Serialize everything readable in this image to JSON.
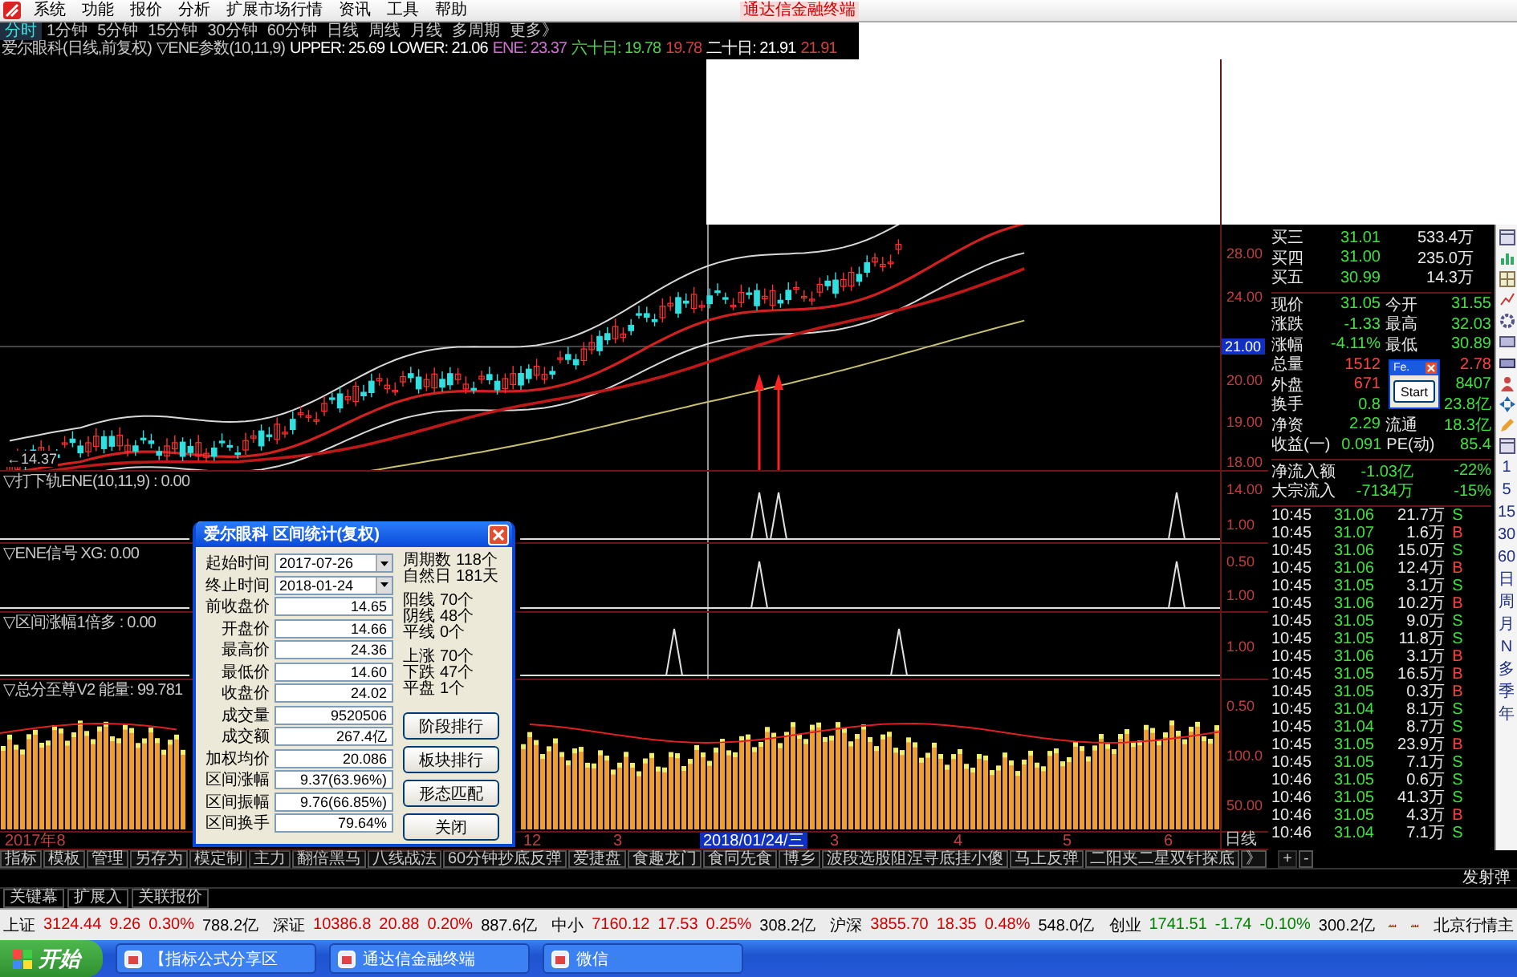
{
  "menu": {
    "items": [
      "系统",
      "功能",
      "报价",
      "分析",
      "扩展市场行情",
      "资讯",
      "工具",
      "帮助"
    ],
    "brand": "通达信金融终端"
  },
  "periods": [
    {
      "label": "分时",
      "selected": true
    },
    {
      "label": "1分钟",
      "selected": false
    },
    {
      "label": "5分钟",
      "selected": false
    },
    {
      "label": "15分钟",
      "selected": false
    },
    {
      "label": "30分钟",
      "selected": false
    },
    {
      "label": "60分钟",
      "selected": false
    },
    {
      "label": "日线",
      "selected": false
    },
    {
      "label": "周线",
      "selected": false
    },
    {
      "label": "月线",
      "selected": false
    },
    {
      "label": "多周期",
      "selected": false
    },
    {
      "label": "更多》",
      "selected": false
    }
  ],
  "indicator_line": [
    {
      "text": "爱尔眼科(日线,前复权)",
      "color": "#c8c8c8"
    },
    {
      "text": "▽ENE参数(10,11,9)",
      "color": "#c8c8c8"
    },
    {
      "text": "UPPER: 25.69",
      "color": "#ffffff"
    },
    {
      "text": "LOWER: 21.06",
      "color": "#ffffff"
    },
    {
      "text": "ENE: 23.37",
      "color": "#d070d0"
    },
    {
      "text": "六十日: 19.78",
      "color": "#50d050"
    },
    {
      "text": "19.78",
      "color": "#d04040"
    },
    {
      "text": "二十日: 21.91",
      "color": "#ffffff"
    },
    {
      "text": "21.91",
      "color": "#d04040"
    }
  ],
  "main_chart": {
    "low_label": "←14.37",
    "price_axis": [
      {
        "label": "28.00",
        "kind": "tick"
      },
      {
        "label": "24.00",
        "kind": "tick"
      },
      {
        "label": "21.00",
        "kind": "cursor"
      },
      {
        "label": "20.00",
        "kind": "tick"
      },
      {
        "label": "19.00",
        "kind": "tick"
      },
      {
        "label": "18.00",
        "kind": "tick"
      }
    ]
  },
  "panels": [
    {
      "title": "▽打下轨ENE(10,11,9) : 0.00",
      "axis": [
        "14.00",
        "1.00"
      ]
    },
    {
      "title": "▽ENE信号 XG: 0.00",
      "axis": [
        "0.50",
        "1.00"
      ]
    },
    {
      "title": "▽区间涨幅1倍多 : 0.00",
      "axis": [
        "1.00"
      ]
    },
    {
      "title": "▽总分至尊V2 能量: 99.781",
      "axis": [
        "0.50",
        "100.0",
        "50.00"
      ]
    }
  ],
  "date_axis": [
    {
      "label": "2017年8",
      "kind": "tick"
    },
    {
      "label": "12",
      "kind": "tick"
    },
    {
      "label": "3",
      "kind": "tick"
    },
    {
      "label": "2018/01/24/三",
      "kind": "cursor"
    },
    {
      "label": "3",
      "kind": "tick"
    },
    {
      "label": "4",
      "kind": "tick"
    },
    {
      "label": "5",
      "kind": "tick"
    },
    {
      "label": "6",
      "kind": "tick"
    }
  ],
  "date_axis_period": "日线",
  "quote": {
    "book": [
      {
        "label": "买三",
        "price": "31.01",
        "volume": "533.4万"
      },
      {
        "label": "买四",
        "price": "31.00",
        "volume": "235.0万"
      },
      {
        "label": "买五",
        "price": "30.99",
        "volume": "14.3万"
      }
    ],
    "details": [
      {
        "label": "现价",
        "value": "31.05",
        "label_2": "今开",
        "value_2": "31.55"
      },
      {
        "label": "涨跌",
        "value": "-1.33",
        "label_2": "最高",
        "value_2": "32.03"
      },
      {
        "label": "涨幅",
        "value": "-4.11%",
        "label_2": "最低",
        "value_2": "30.89"
      },
      {
        "label": "总量",
        "value": "1512",
        "value_2": "2.78"
      },
      {
        "label": "外盘",
        "value": "671",
        "value_2": "8407"
      },
      {
        "label": "换手",
        "value": "0.8",
        "value_2": "23.8亿"
      },
      {
        "label": "净资",
        "value": "2.29",
        "label_2": "流通",
        "value_2": "18.3亿"
      },
      {
        "label": "收益(一)",
        "value": "0.091",
        "label_2": "PE(动)",
        "value_2": "85.4"
      }
    ],
    "flows": [
      {
        "label": "净流入额",
        "value": "-1.03亿",
        "pct": "-22%"
      },
      {
        "label": "大宗流入",
        "value": "-7134万",
        "pct": "-15%"
      }
    ],
    "ticks": [
      {
        "time": "10:45",
        "price": "31.06",
        "volume": "21.7万",
        "side": "S",
        "kind": "sell"
      },
      {
        "time": "10:45",
        "price": "31.07",
        "volume": "1.6万",
        "side": "B",
        "kind": "buy"
      },
      {
        "time": "10:45",
        "price": "31.06",
        "volume": "15.0万",
        "side": "S",
        "kind": "sell"
      },
      {
        "time": "10:45",
        "price": "31.06",
        "volume": "12.4万",
        "side": "B",
        "kind": "buy"
      },
      {
        "time": "10:45",
        "price": "31.05",
        "volume": "3.1万",
        "side": "S",
        "kind": "sell"
      },
      {
        "time": "10:45",
        "price": "31.06",
        "volume": "10.2万",
        "side": "B",
        "kind": "buy"
      },
      {
        "time": "10:45",
        "price": "31.05",
        "volume": "9.0万",
        "side": "S",
        "kind": "sell"
      },
      {
        "time": "10:45",
        "price": "31.05",
        "volume": "11.8万",
        "side": "S",
        "kind": "sell"
      },
      {
        "time": "10:45",
        "price": "31.06",
        "volume": "3.1万",
        "side": "B",
        "kind": "buy"
      },
      {
        "time": "10:45",
        "price": "31.05",
        "volume": "16.5万",
        "side": "B",
        "kind": "buy"
      },
      {
        "time": "10:45",
        "price": "31.05",
        "volume": "0.3万",
        "side": "B",
        "kind": "buy"
      },
      {
        "time": "10:45",
        "price": "31.04",
        "volume": "8.1万",
        "side": "S",
        "kind": "sell"
      },
      {
        "time": "10:45",
        "price": "31.04",
        "volume": "8.7万",
        "side": "S",
        "kind": "sell"
      },
      {
        "time": "10:45",
        "price": "31.05",
        "volume": "23.9万",
        "side": "B",
        "kind": "buy"
      },
      {
        "time": "10:45",
        "price": "31.05",
        "volume": "7.1万",
        "side": "S",
        "kind": "sell"
      },
      {
        "time": "10:46",
        "price": "31.05",
        "volume": "0.6万",
        "side": "S",
        "kind": "sell"
      },
      {
        "time": "10:46",
        "price": "31.05",
        "volume": "41.3万",
        "side": "S",
        "kind": "sell"
      },
      {
        "time": "10:46",
        "price": "31.05",
        "volume": "4.3万",
        "side": "B",
        "kind": "buy"
      },
      {
        "time": "10:46",
        "price": "31.04",
        "volume": "7.1万",
        "side": "S",
        "kind": "sell"
      }
    ]
  },
  "side_periods": [
    "1",
    "5",
    "15",
    "30",
    "60",
    "日",
    "周",
    "月",
    "N",
    "多",
    "季",
    "年"
  ],
  "bottom_tabs": [
    "指标",
    "模板",
    "管理",
    "另存为",
    "模定制",
    "主力",
    "翻倍黑马",
    "八线战法",
    "60分钟抄底反弹",
    "爱捷盘",
    "食趣龙门",
    "食同先食",
    "博乡",
    "波段选股阻涅寻底挂小傻",
    "马上反弹",
    "二阳夹二星双针探底",
    "》"
  ],
  "zoom_buttons": [
    "+",
    "-"
  ],
  "message": "发射弹",
  "sub_tabs": [
    "关键幕",
    "扩展入",
    "关联报价"
  ],
  "ticker": {
    "items": [
      {
        "name": "上证",
        "value": "3124.44",
        "change": "9.26",
        "pct": "0.30%",
        "amount": "788.2亿",
        "color": "#d00000"
      },
      {
        "name": "深证",
        "value": "10386.8",
        "change": "20.88",
        "pct": "0.20%",
        "amount": "887.6亿",
        "color": "#d00000"
      },
      {
        "name": "中小",
        "value": "7160.12",
        "change": "17.53",
        "pct": "0.25%",
        "amount": "308.2亿",
        "color": "#d00000"
      },
      {
        "name": "沪深",
        "value": "3855.70",
        "change": "18.35",
        "pct": "0.48%",
        "amount": "548.0亿",
        "color": "#d00000"
      },
      {
        "name": "创业",
        "value": "1741.51",
        "change": "-1.74",
        "pct": "-0.10%",
        "amount": "300.2亿",
        "color": "#008000"
      }
    ],
    "right": "北京行情主"
  },
  "taskbar": {
    "start": "开始",
    "tasks": [
      "【指标公式分享区",
      "通达信金融终端",
      "微信"
    ]
  },
  "dialog": {
    "title": "爱尔眼科 区间统计(复权)",
    "date_fields": [
      {
        "label": "起始时间",
        "value": "2017-07-26"
      },
      {
        "label": "终止时间",
        "value": "2018-01-24"
      }
    ],
    "fields": [
      {
        "label": "前收盘价",
        "value": "14.65"
      },
      {
        "label": "开盘价",
        "value": "14.66"
      },
      {
        "label": "最高价",
        "value": "24.36"
      },
      {
        "label": "最低价",
        "value": "14.60"
      },
      {
        "label": "收盘价",
        "value": "24.02"
      },
      {
        "label": "成交量",
        "value": "9520506"
      },
      {
        "label": "成交额",
        "value": "267.4亿"
      },
      {
        "label": "加权均价",
        "value": "20.086"
      },
      {
        "label": "区间涨幅",
        "value": "9.37(63.96%)"
      },
      {
        "label": "区间振幅",
        "value": "9.76(66.85%)"
      },
      {
        "label": "区间换手",
        "value": "79.64%"
      }
    ],
    "stats": [
      [
        {
          "label": "周期数",
          "value": "118个"
        },
        {
          "label": "自然日",
          "value": "181天"
        }
      ],
      [
        {
          "label": "阳线",
          "value": "70个"
        },
        {
          "label": "阴线",
          "value": "48个"
        },
        {
          "label": "平线",
          "value": "0个"
        }
      ],
      [
        {
          "label": "上涨",
          "value": "70个"
        },
        {
          "label": "下跌",
          "value": "47个"
        },
        {
          "label": "平盘",
          "value": "1个"
        }
      ]
    ],
    "buttons": [
      "阶段排行",
      "板块排行",
      "形态匹配",
      "关闭"
    ]
  },
  "popup": {
    "title": "Fe.",
    "button": "Start"
  }
}
